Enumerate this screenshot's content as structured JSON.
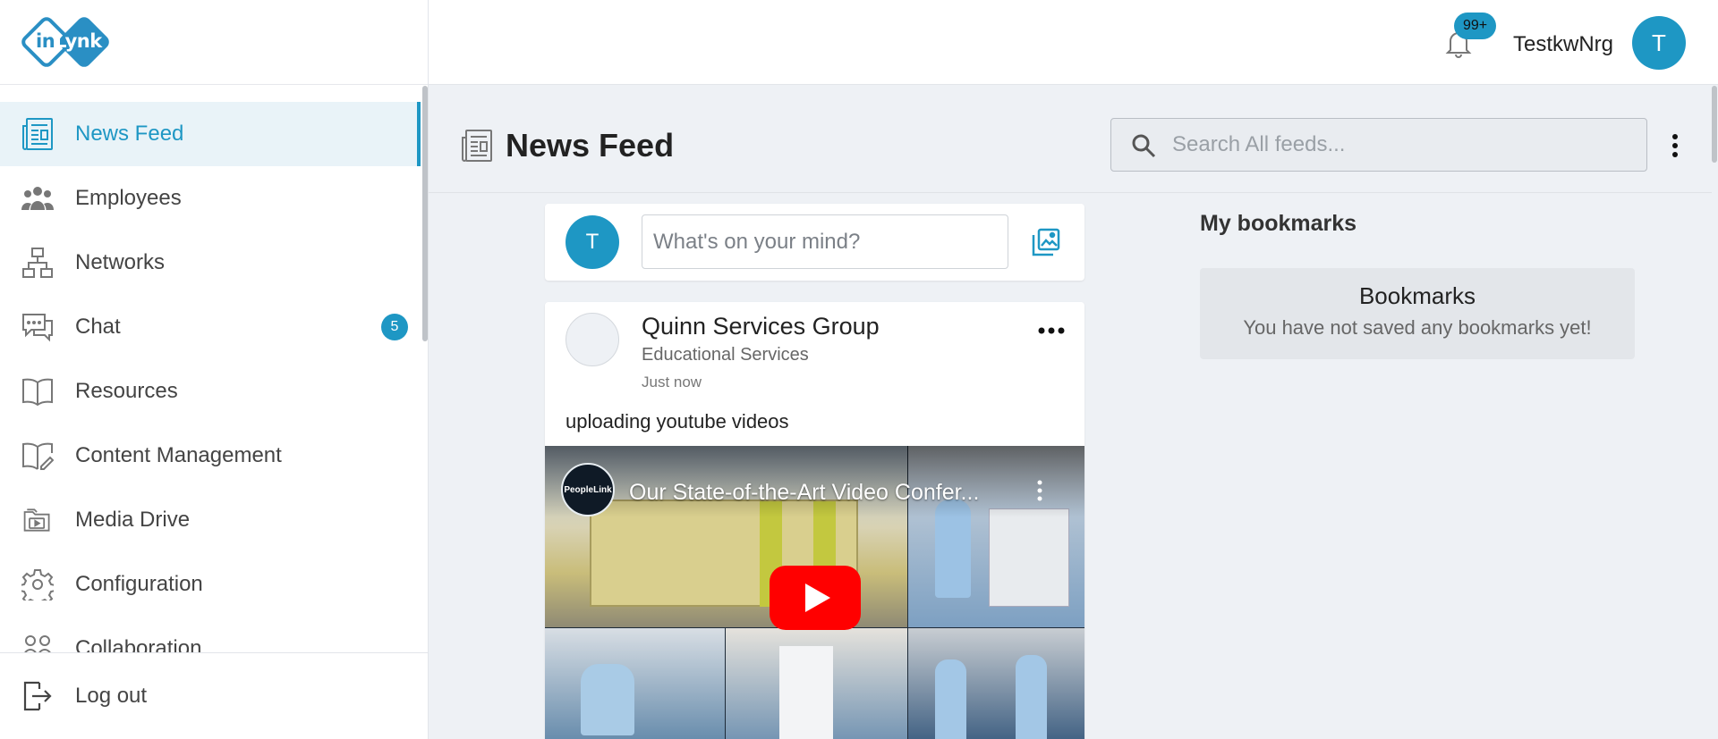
{
  "brand": {
    "logo_text_left": "in",
    "logo_text_right": "Lynk"
  },
  "sidebar": {
    "items": [
      {
        "label": "News Feed",
        "icon": "newspaper-icon",
        "active": true
      },
      {
        "label": "Employees",
        "icon": "people-icon"
      },
      {
        "label": "Networks",
        "icon": "network-icon"
      },
      {
        "label": "Chat",
        "icon": "chat-icon",
        "badge": "5"
      },
      {
        "label": "Resources",
        "icon": "book-icon"
      },
      {
        "label": "Content Management",
        "icon": "book-edit-icon"
      },
      {
        "label": "Media Drive",
        "icon": "media-folder-icon"
      },
      {
        "label": "Configuration",
        "icon": "gear-icon"
      },
      {
        "label": "Collaboration",
        "icon": "collaboration-icon"
      }
    ],
    "logout": "Log out"
  },
  "topbar": {
    "notification_count": "99+",
    "username": "TestkwNrg",
    "avatar_initial": "T"
  },
  "page": {
    "title": "News Feed",
    "search_placeholder": "Search All feeds..."
  },
  "composer": {
    "avatar_initial": "T",
    "placeholder": "What's on your mind?"
  },
  "post": {
    "author": "Quinn Services Group",
    "category": "Educational Services",
    "time": "Just now",
    "text": "uploading youtube videos",
    "video": {
      "channel": "PeopleLink",
      "title": "Our State-of-the-Art Video Confer..."
    }
  },
  "bookmarks": {
    "title": "My bookmarks",
    "card_heading": "Bookmarks",
    "card_message": "You have not saved any bookmarks yet!"
  },
  "colors": {
    "accent": "#1e97c4",
    "logo": "#2a8fc4",
    "background": "#eef1f5"
  }
}
